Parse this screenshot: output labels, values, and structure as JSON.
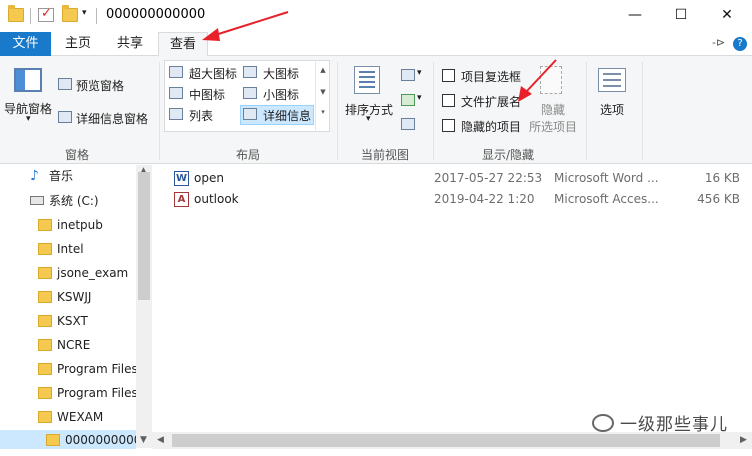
{
  "window": {
    "title": "000000000000",
    "controls": {
      "minimize": "—",
      "maximize": "☐",
      "close": "✕"
    }
  },
  "tabs": {
    "file": "文件",
    "home": "主页",
    "share": "共享",
    "view": "查看",
    "pin": "-⊳",
    "help": "?"
  },
  "ribbon": {
    "panes": {
      "label": "窗格",
      "nav_pane": "导航窗格",
      "preview_pane": "预览窗格",
      "details_pane": "详细信息窗格"
    },
    "layout": {
      "label": "布局",
      "items": [
        "超大图标",
        "大图标",
        "中图标",
        "小图标",
        "列表",
        "详细信息"
      ]
    },
    "current_view": {
      "label": "当前视图",
      "sort_by": "排序方式"
    },
    "show_hide": {
      "label": "显示/隐藏",
      "item_checkboxes": "项目复选框",
      "file_extensions": "文件扩展名",
      "hidden_items": "隐藏的项目",
      "hide": "隐藏",
      "selected_items": "所选项目"
    },
    "options": "选项"
  },
  "nav": {
    "items": [
      {
        "label": "音乐",
        "icon": "music-icon"
      },
      {
        "label": "系统 (C:)",
        "icon": "drive-icon"
      },
      {
        "label": "inetpub",
        "icon": "folder-icon"
      },
      {
        "label": "Intel",
        "icon": "folder-icon"
      },
      {
        "label": "jsone_exam",
        "icon": "folder-icon"
      },
      {
        "label": "KSWJJ",
        "icon": "folder-icon"
      },
      {
        "label": "KSXT",
        "icon": "folder-icon"
      },
      {
        "label": "NCRE",
        "icon": "folder-icon"
      },
      {
        "label": "Program Files",
        "icon": "folder-icon"
      },
      {
        "label": "Program Files",
        "icon": "folder-icon"
      },
      {
        "label": "WEXAM",
        "icon": "folder-icon"
      },
      {
        "label": "0000000000",
        "icon": "folder-icon"
      }
    ]
  },
  "files": [
    {
      "name": "open",
      "date": "2017-05-27 22:53",
      "type": "Microsoft Word ...",
      "size": "16 KB",
      "icon": "word-icon"
    },
    {
      "name": "outlook",
      "date": "2019-04-22 1:20",
      "type": "Microsoft Acces...",
      "size": "456 KB",
      "icon": "access-icon"
    }
  ],
  "watermark": "一级那些事儿",
  "colors": {
    "accent": "#1979ca",
    "selection": "#cce8ff",
    "annotation_arrow": "#e8202a"
  }
}
